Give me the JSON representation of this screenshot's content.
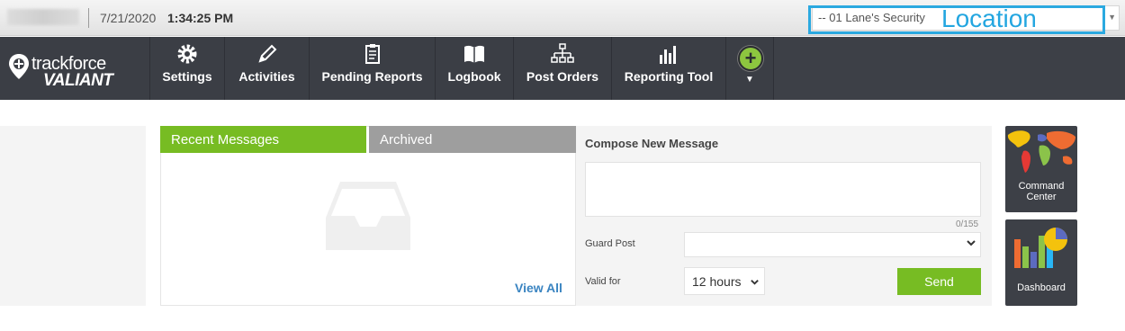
{
  "topbar": {
    "date": "7/21/2020",
    "time": "1:34:25 PM",
    "location_value": "-- 01 Lane's Security",
    "location_annotation": "Location"
  },
  "logo": {
    "line1": "trackforce",
    "line2": "VALIANT"
  },
  "nav": {
    "items": [
      {
        "label": "Settings",
        "icon": "gear-icon"
      },
      {
        "label": "Activities",
        "icon": "pencil-icon"
      },
      {
        "label": "Pending Reports",
        "icon": "clipboard-icon"
      },
      {
        "label": "Logbook",
        "icon": "book-icon"
      },
      {
        "label": "Post Orders",
        "icon": "org-chart-icon"
      },
      {
        "label": "Reporting Tool",
        "icon": "bar-chart-icon"
      }
    ],
    "add_symbol": "+"
  },
  "messages": {
    "tab_recent": "Recent Messages",
    "tab_archived": "Archived",
    "view_all": "View All"
  },
  "compose": {
    "title": "Compose New Message",
    "char_count": "0/155",
    "guard_post_label": "Guard Post",
    "guard_post_value": "",
    "valid_for_label": "Valid for",
    "valid_for_value": "12 hours",
    "send_label": "Send"
  },
  "tiles": {
    "command_center_line1": "Command",
    "command_center_line2": "Center",
    "dashboard": "Dashboard"
  },
  "colors": {
    "accent_green": "#77bc23",
    "nav_bg": "#3b3e45",
    "link_blue": "#3a84c1",
    "annotation_blue": "#2ba9e0"
  }
}
